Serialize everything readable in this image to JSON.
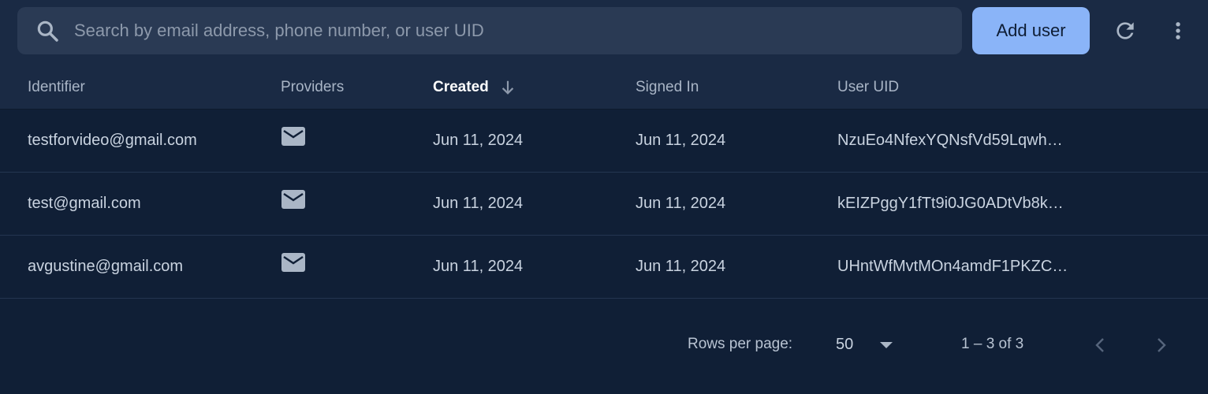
{
  "search": {
    "placeholder": "Search by email address, phone number, or user UID",
    "value": ""
  },
  "toolbar": {
    "add_user_label": "Add user",
    "refresh_icon": "refresh-icon",
    "more_icon": "more-vert-icon"
  },
  "table": {
    "columns": {
      "identifier": "Identifier",
      "providers": "Providers",
      "created": "Created",
      "signed_in": "Signed In",
      "user_uid": "User UID"
    },
    "sort": {
      "column": "Created",
      "direction": "descending"
    },
    "rows": [
      {
        "identifier": "testforvideo@gmail.com",
        "provider_icon": "email-icon",
        "created": "Jun 11, 2024",
        "signed_in": "Jun 11, 2024",
        "uid": "NzuEo4NfexYQNsfVd59Lqwh…"
      },
      {
        "identifier": "test@gmail.com",
        "provider_icon": "email-icon",
        "created": "Jun 11, 2024",
        "signed_in": "Jun 11, 2024",
        "uid": "kEIZPggY1fTt9i0JG0ADtVb8k…"
      },
      {
        "identifier": "avgustine@gmail.com",
        "provider_icon": "email-icon",
        "created": "Jun 11, 2024",
        "signed_in": "Jun 11, 2024",
        "uid": "UHntWfMvtMOn4amdF1PKZC…"
      }
    ]
  },
  "pagination": {
    "rows_per_page_label": "Rows per page:",
    "rows_per_page_value": "50",
    "range": "1 – 3 of 3"
  },
  "colors": {
    "background": "#101f36",
    "toolbar": "#1a2a44",
    "accent": "#8ab4f8"
  }
}
